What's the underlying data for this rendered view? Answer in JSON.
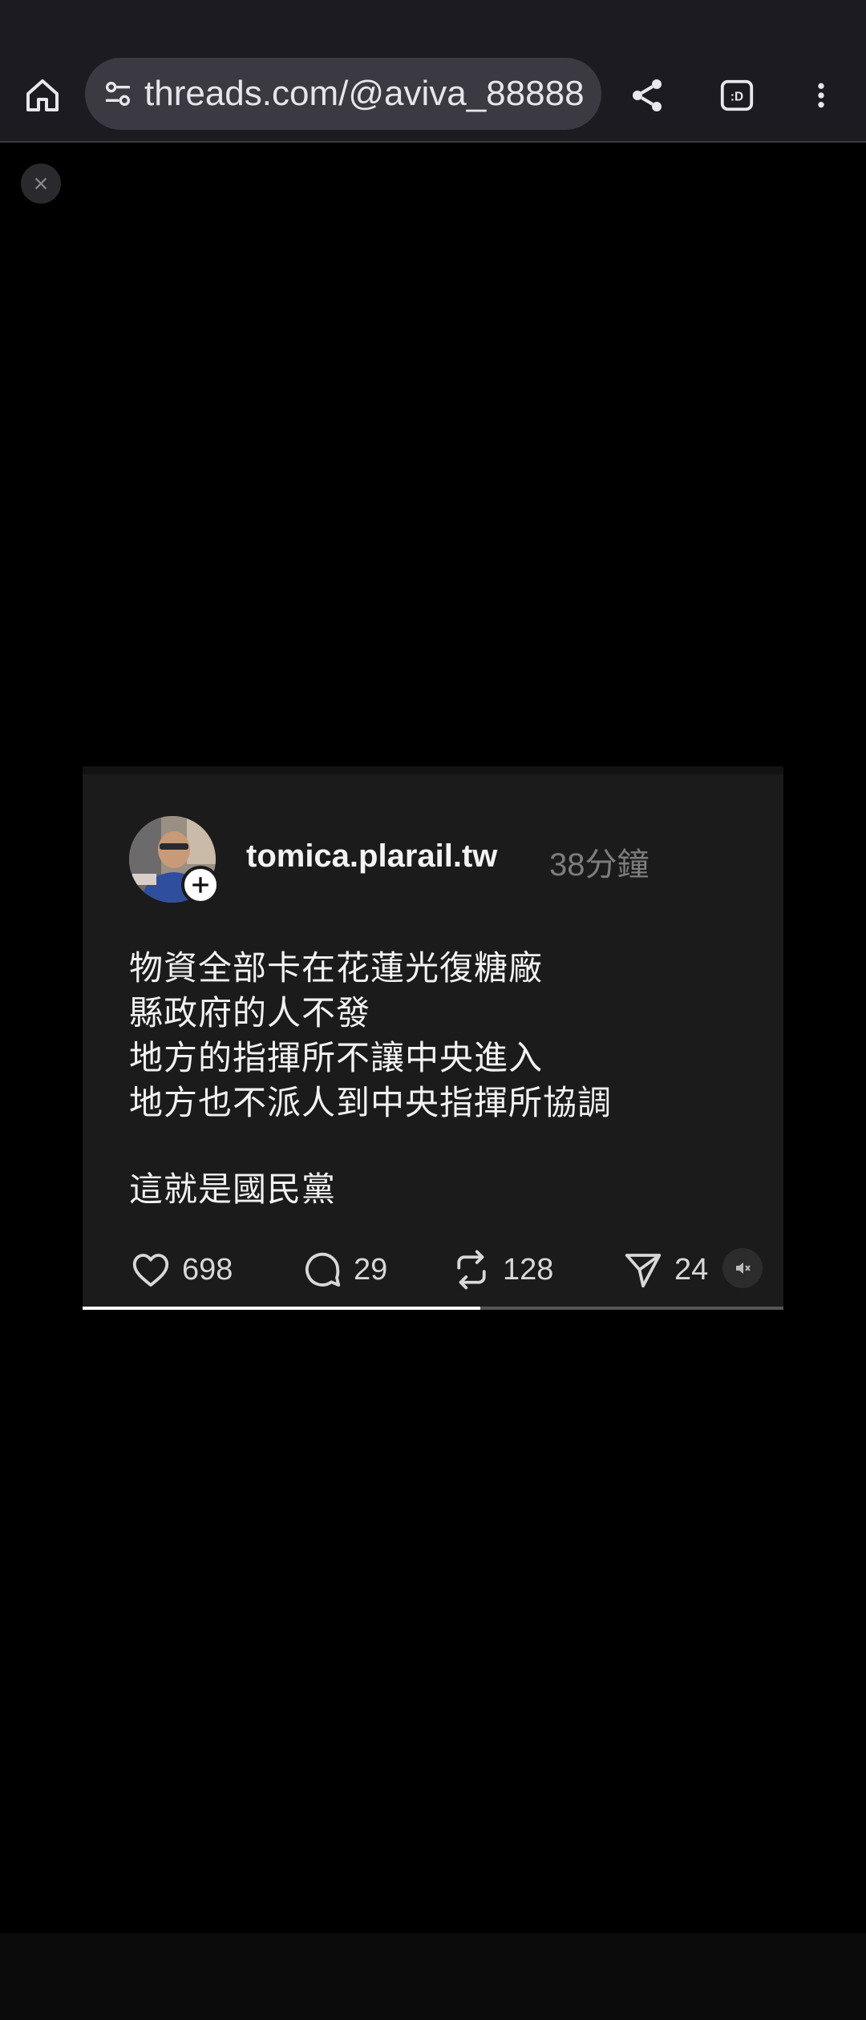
{
  "browser": {
    "url": "threads.com/@aviva_88888",
    "home_icon": "home-icon",
    "site_settings_icon": "tune-icon",
    "share_icon": "share-icon",
    "extension_icon": "extension-icon",
    "extension_label": ":D",
    "menu_icon": "kebab-menu-icon"
  },
  "overlay": {
    "close_icon": "close-icon"
  },
  "post": {
    "username": "tomica.plarail.tw",
    "time_ago": "38分鐘",
    "lines": [
      "物資全部卡在花蓮光復糖廠",
      "縣政府的人不發",
      "地方的指揮所不讓中央進入",
      "地方也不派人到中央指揮所協調",
      "這就是國民黨"
    ],
    "actions": {
      "likes": "698",
      "replies": "29",
      "reposts": "128",
      "shares": "24"
    }
  },
  "video": {
    "progress": 0.568,
    "muted": true
  },
  "colors": {
    "browser_bg": "#1c1b22",
    "url_pill_bg": "#3b3a42",
    "page_bg": "#000000",
    "card_bg": "#1b1b1b"
  }
}
